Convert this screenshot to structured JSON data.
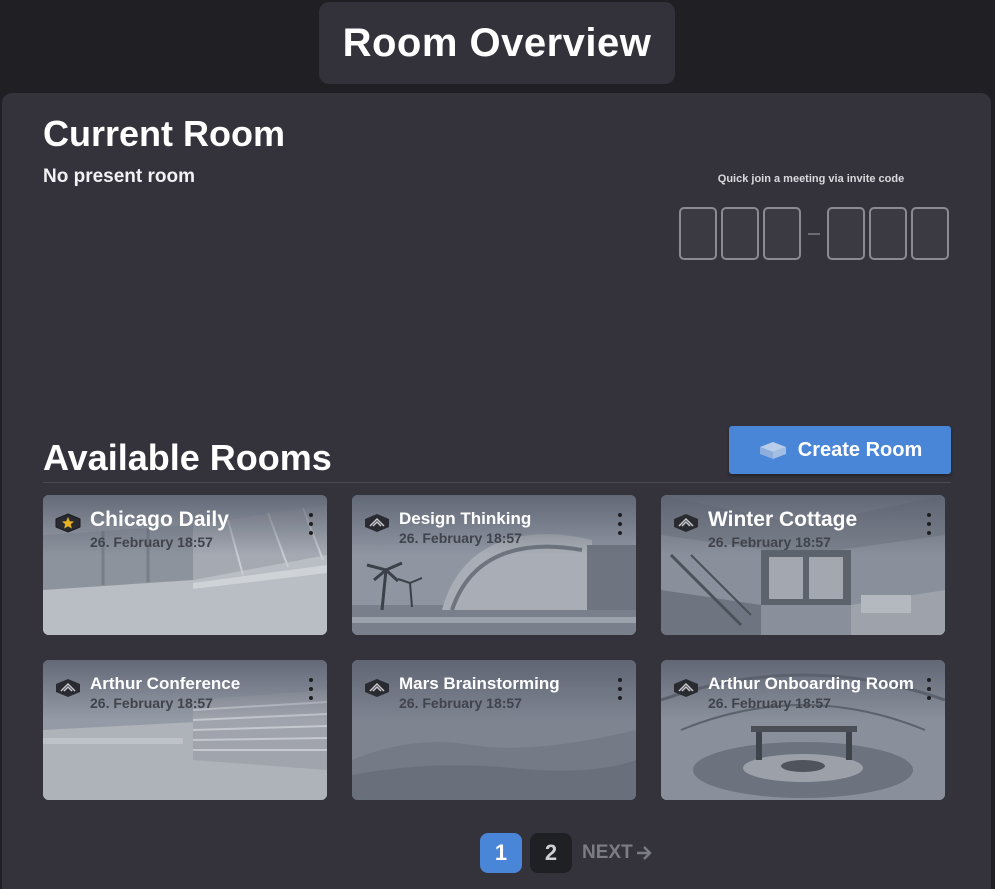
{
  "header": {
    "title": "Room Overview"
  },
  "current_room": {
    "title": "Current Room",
    "status": "No present room"
  },
  "quick_join": {
    "label": "Quick join a meeting via invite code"
  },
  "available_rooms": {
    "title": "Available Rooms",
    "create_label": "Create Room",
    "rooms": [
      {
        "name": "Chicago Daily",
        "date": "26. February 18:57",
        "icon": "star-room-icon"
      },
      {
        "name": "Design Thinking",
        "date": "26. February 18:57",
        "icon": "room-icon"
      },
      {
        "name": "Winter Cottage",
        "date": "26. February 18:57",
        "icon": "room-icon"
      },
      {
        "name": "Arthur Conference",
        "date": "26. February 18:57",
        "icon": "room-icon"
      },
      {
        "name": "Mars Brainstorming",
        "date": "26. February 18:57",
        "icon": "room-icon"
      },
      {
        "name": "Arthur Onboarding Room",
        "date": "26. February 18:57",
        "icon": "room-icon"
      }
    ]
  },
  "pagination": {
    "pages": [
      "1",
      "2"
    ],
    "current": "1",
    "next_label": "NEXT"
  },
  "colors": {
    "accent": "#4a86d8",
    "panel": "#34333b",
    "background": "#1f1f24",
    "star": "#e8b323"
  }
}
